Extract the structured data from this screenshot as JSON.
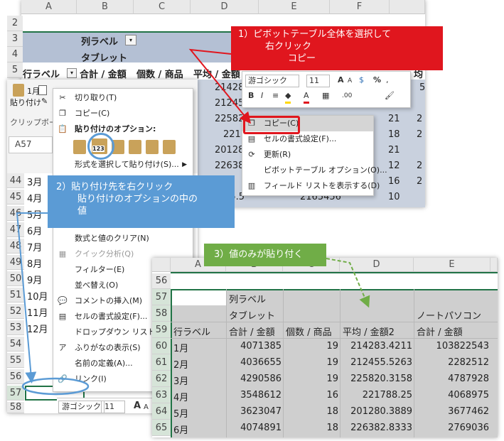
{
  "top_sheet": {
    "col_headers": [
      "A",
      "B",
      "C",
      "D",
      "E",
      "F"
    ],
    "row_headers": [
      "2",
      "3",
      "4",
      "5"
    ],
    "col_label": "列ラベル",
    "tablet": "タブレット",
    "row_label": "行ラベル",
    "sum_amount": "合計 / 金額",
    "count_product": "個数 / 商品",
    "avg_amount": "平均 / 金額",
    "col_e_partial": "ノ",
    "col_f_partial": "均",
    "d_values": [
      "214283",
      "212455",
      "225820",
      "2217",
      "201280",
      "226382",
      "206415.5"
    ],
    "e_last": "2165456",
    "f_values": [
      "5",
      "20",
      "21",
      "18",
      "21",
      "12",
      "16",
      "10"
    ],
    "f2_values": [
      "2",
      "2",
      "2",
      "2"
    ]
  },
  "left_panel": {
    "clipboard_group": "クリップボード",
    "paste_label": "貼り付け",
    "name_box": "A57",
    "row_headers": [
      "44",
      "45",
      "46",
      "47",
      "48",
      "49",
      "50",
      "51",
      "52",
      "53",
      "54",
      "55",
      "56",
      "57",
      "58"
    ],
    "month_cells": [
      "3月",
      "4月",
      "5月",
      "6月",
      "7月",
      "8月",
      "9月",
      "10月",
      "11月",
      "12月"
    ],
    "cutoff_row": "1月",
    "mini_font": "游ゴシック",
    "mini_size": "11",
    "mini_a": "A"
  },
  "context_menu_left": {
    "cut": "切り取り(T)",
    "copy": "コピー(C)",
    "paste_options_header": "貼り付けのオプション:",
    "paste_special": "形式を選択して貼り付け(S)...",
    "clear": "数式と値のクリア(N)",
    "quick_analysis": "クイック分析(Q)",
    "filter": "フィルター(E)",
    "sort": "並べ替え(O)",
    "insert_comment": "コメントの挿入(M)",
    "format_cells": "セルの書式設定(F)...",
    "dropdown_pick": "ドロップダウン リストから選択",
    "phonetic": "ふりがなの表示(S)",
    "define_name": "名前の定義(A)...",
    "link": "リンク(I)",
    "values_badge": "123"
  },
  "mini_toolbar": {
    "font": "游ゴシック",
    "size": "11",
    "percent": "%"
  },
  "context_menu_right": {
    "copy": "コピー(C)",
    "format_cells": "セルの書式設定(F)...",
    "refresh": "更新(R)",
    "pivot_options": "ピボットテーブル オプション(O)...",
    "field_list": "フィールド リストを表示する(D)"
  },
  "callouts": {
    "step1": [
      "1）ピボットテーブル全体を選択して",
      "右クリック",
      "コピー"
    ],
    "step2": [
      "2）貼り付け先を右クリック",
      "貼り付けのオプションの中の",
      "値"
    ],
    "step3": "3）値のみが貼り付く"
  },
  "result_sheet": {
    "col_headers": [
      "A",
      "B",
      "C",
      "D",
      "E"
    ],
    "col_label": "列ラベル",
    "tablet": "タブレット",
    "notebook": "ノートパソコン",
    "row_label": "行ラベル",
    "sum_amount": "合計 / 金額",
    "count_product": "個数 / 商品",
    "avg_amount2": "平均 / 金額2",
    "sum_amount_e": "合計 / 金額",
    "rows": [
      {
        "row": "60",
        "label": "1月",
        "amount": "4071385",
        "count": "19",
        "avg": "214283.4211",
        "e": "103822543"
      },
      {
        "row": "61",
        "label": "2月",
        "amount": "4036655",
        "count": "19",
        "avg": "212455.5263",
        "e": "2282512"
      },
      {
        "row": "62",
        "label": "3月",
        "amount": "4290586",
        "count": "19",
        "avg": "225820.3158",
        "e": "4787928"
      },
      {
        "row": "63",
        "label": "4月",
        "amount": "3548612",
        "count": "16",
        "avg": "221788.25",
        "e": "4068975"
      },
      {
        "row": "64",
        "label": "5月",
        "amount": "3623047",
        "count": "18",
        "avg": "201280.3889",
        "e": "3677462"
      },
      {
        "row": "65",
        "label": "6月",
        "amount": "4074891",
        "count": "18",
        "avg": "226382.8333",
        "e": "2769036"
      }
    ],
    "header_rows": [
      "56",
      "57",
      "58",
      "59"
    ]
  },
  "colors": {
    "red": "#e0161e",
    "blue": "#5b9bd5",
    "green": "#70ad47",
    "pivot_header": "#b4c0d4",
    "selection": "#217346"
  }
}
